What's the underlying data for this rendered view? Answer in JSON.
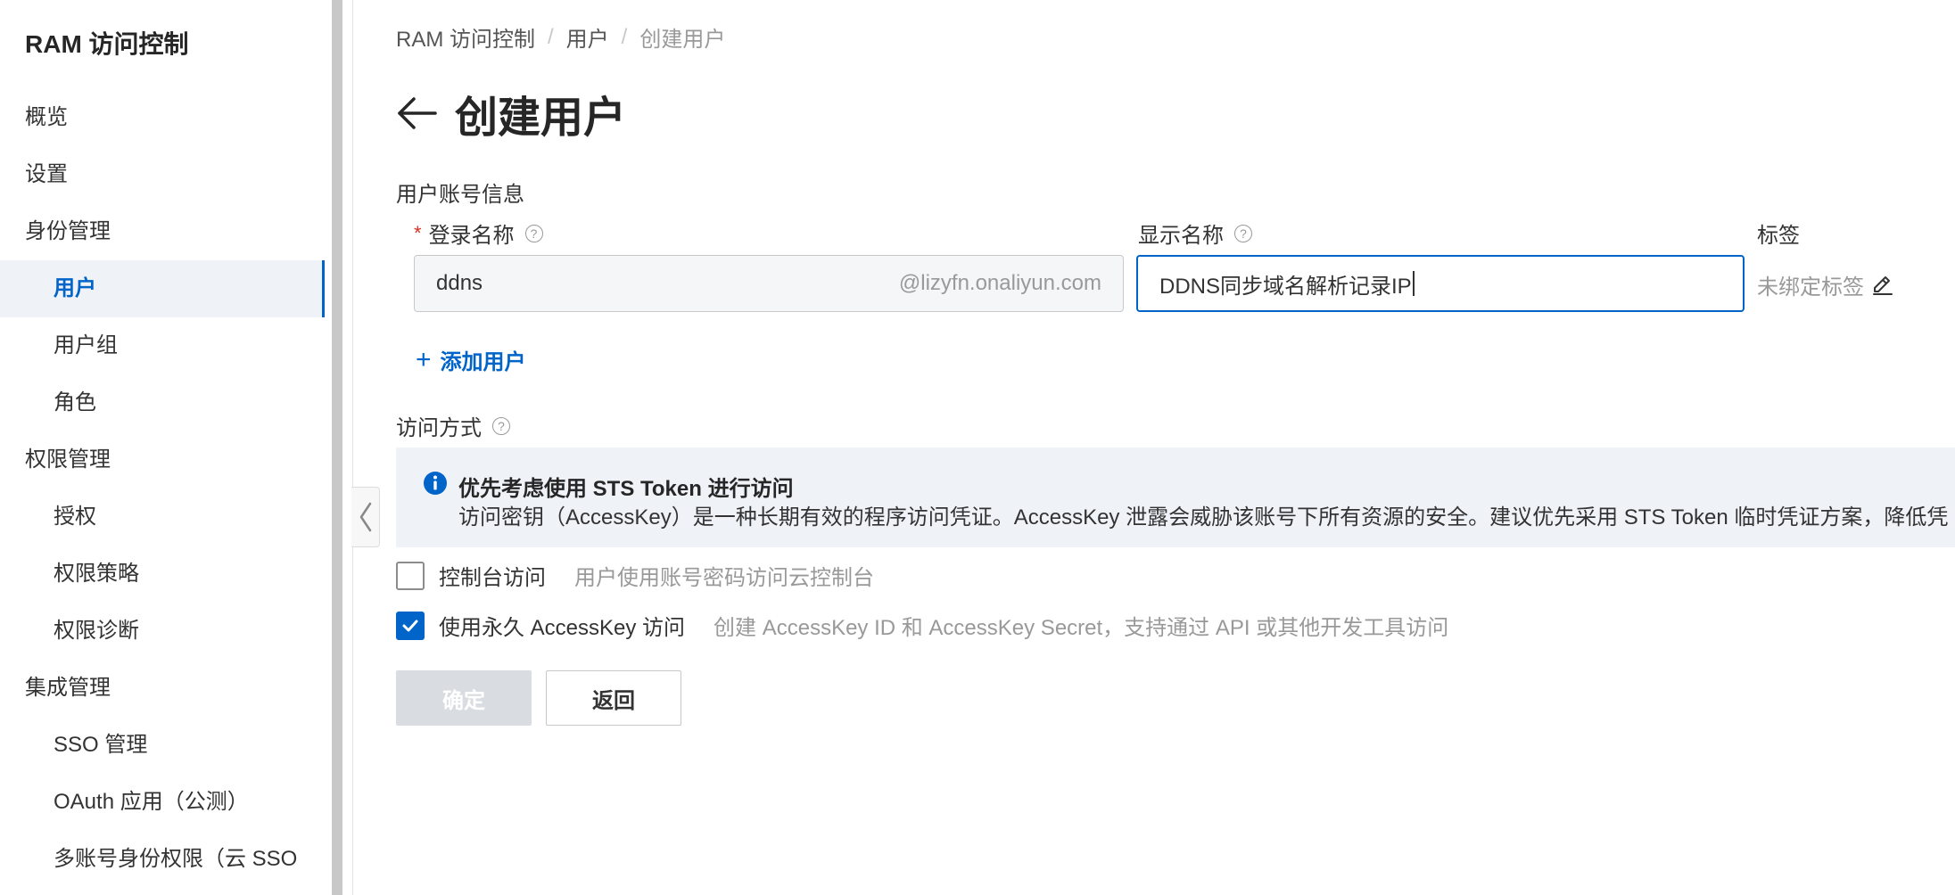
{
  "sidebar": {
    "title": "RAM 访问控制",
    "items": [
      {
        "label": "概览"
      },
      {
        "label": "设置"
      },
      {
        "label": "身份管理"
      },
      {
        "label": "用户"
      },
      {
        "label": "用户组"
      },
      {
        "label": "角色"
      },
      {
        "label": "权限管理"
      },
      {
        "label": "授权"
      },
      {
        "label": "权限策略"
      },
      {
        "label": "权限诊断"
      },
      {
        "label": "集成管理"
      },
      {
        "label": "SSO 管理"
      },
      {
        "label": "OAuth 应用（公测）"
      },
      {
        "label": "多账号身份权限（云 SSO"
      }
    ],
    "active_item": "用户"
  },
  "breadcrumb": [
    "RAM 访问控制",
    "用户",
    "创建用户"
  ],
  "page": {
    "title": "创建用户"
  },
  "account_info": {
    "section_label": "用户账号信息",
    "login_name": {
      "label": "登录名称",
      "required": "*",
      "value": "ddns",
      "suffix": "@lizyfn.onaliyun.com"
    },
    "display_name": {
      "label": "显示名称",
      "value": "DDNS同步域名解析记录IP"
    },
    "tags": {
      "label": "标签",
      "value": "未绑定标签"
    },
    "add_user_label": "添加用户"
  },
  "access": {
    "section_label": "访问方式",
    "info": {
      "title": "优先考虑使用 STS Token 进行访问",
      "desc": "访问密钥（AccessKey）是一种长期有效的程序访问凭证。AccessKey 泄露会威胁该账号下所有资源的安全。建议优先采用 STS Token 临时凭证方案，降低凭"
    },
    "options": [
      {
        "label": "控制台访问",
        "desc": "用户使用账号密码访问云控制台",
        "checked": false
      },
      {
        "label": "使用永久 AccessKey 访问",
        "desc": "创建 AccessKey ID 和 AccessKey Secret，支持通过 API 或其他开发工具访问",
        "checked": true
      }
    ]
  },
  "buttons": {
    "confirm": "确定",
    "back": "返回"
  },
  "colors": {
    "accent": "#0064c8",
    "info_bg": "#eff3f8",
    "required": "#d93026",
    "disabled_btn": "#d9dce0"
  }
}
